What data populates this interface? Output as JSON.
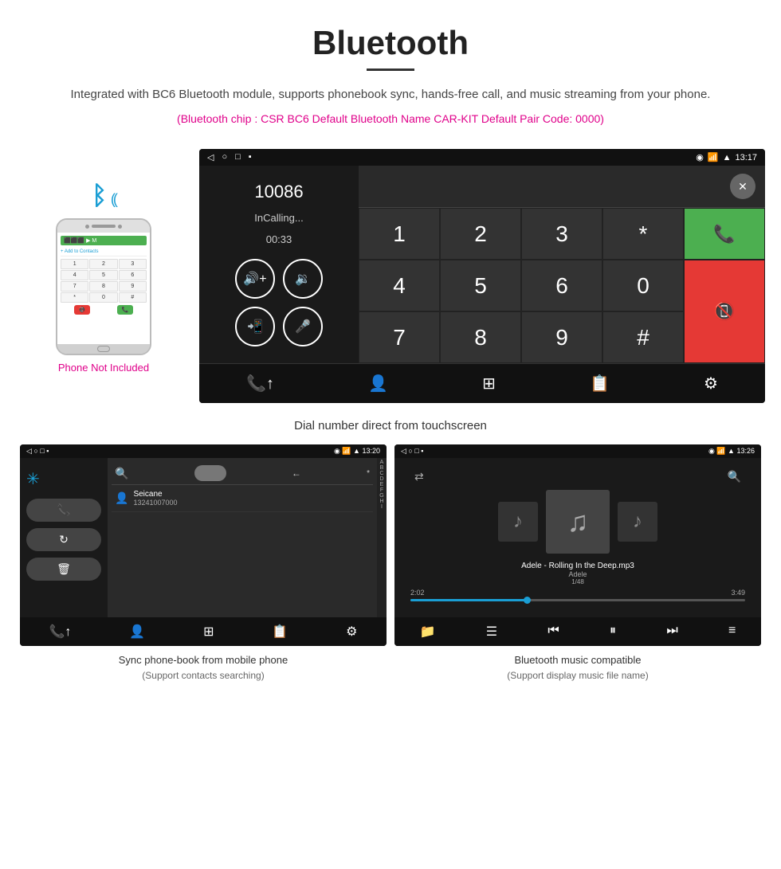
{
  "page": {
    "title": "Bluetooth",
    "description": "Integrated with BC6 Bluetooth module, supports phonebook sync, hands-free call, and music streaming from your phone.",
    "specs": "(Bluetooth chip : CSR BC6    Default Bluetooth Name CAR-KIT    Default Pair Code: 0000)",
    "main_caption": "Dial number direct from touchscreen",
    "bottom_left_caption": "Sync phone-book from mobile phone",
    "bottom_left_sub": "(Support contacts searching)",
    "bottom_right_caption": "Bluetooth music compatible",
    "bottom_right_sub": "(Support display music file name)",
    "phone_not_included": "Phone Not Included"
  },
  "main_screen": {
    "status_time": "13:17",
    "call_number": "10086",
    "call_status": "InCalling...",
    "call_timer": "00:33",
    "keypad_keys": [
      "1",
      "2",
      "3",
      "*",
      "4",
      "5",
      "6",
      "0",
      "7",
      "8",
      "9",
      "#"
    ],
    "backspace": "⌫"
  },
  "phonebook_screen": {
    "status_time": "13:20",
    "contact_name": "Seicane",
    "contact_number": "13241007000",
    "alpha_letters": [
      "A",
      "B",
      "C",
      "D",
      "E",
      "F",
      "G",
      "H",
      "I"
    ]
  },
  "music_screen": {
    "status_time": "13:26",
    "track_name": "Adele - Rolling In the Deep.mp3",
    "artist": "Adele",
    "track_num": "1/48",
    "time_current": "2:02",
    "time_total": "3:49"
  },
  "icons": {
    "bluetooth": "⚡",
    "phone_call": "📞",
    "volume_up": "🔊",
    "volume_down": "🔉",
    "transfer": "📲",
    "mic": "🎤",
    "back": "◁",
    "home": "○",
    "recent": "□",
    "search": "🔍",
    "person": "👤",
    "grid": "⊞",
    "settings": "⚙",
    "music": "♪",
    "shuffle": "⇄",
    "prev": "⏮",
    "pause": "⏸",
    "next": "⏭",
    "equalizer": "≡",
    "folder": "📁",
    "list": "☰",
    "delete": "🗑",
    "refresh": "↻"
  }
}
